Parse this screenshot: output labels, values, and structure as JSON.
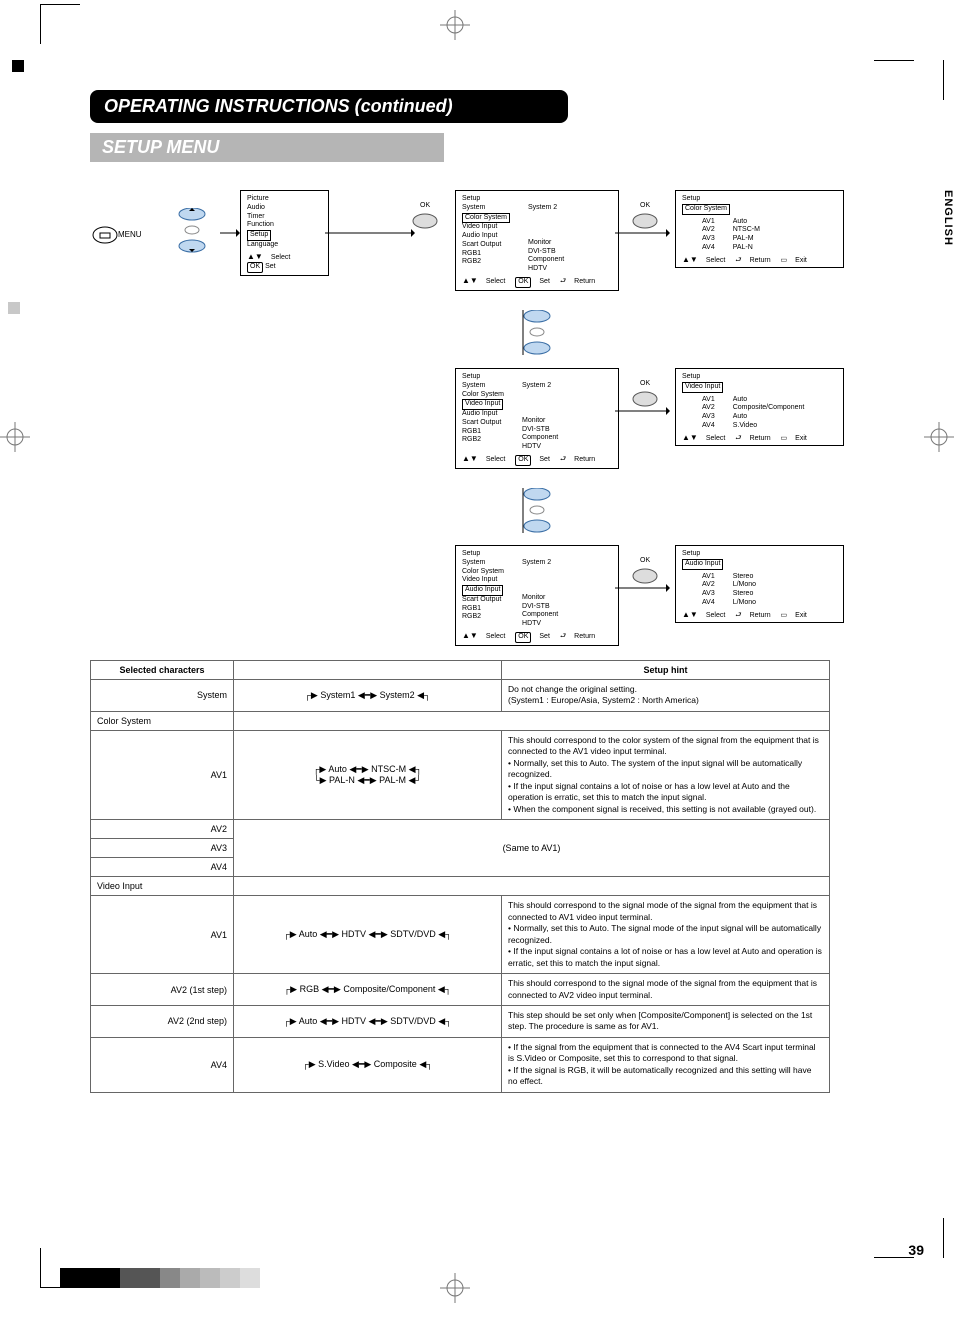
{
  "header": {
    "title": "OPERATING INSTRUCTIONS (continued)",
    "subtitle": "SETUP MENU"
  },
  "lang": "ENGLISH",
  "pagenum": "39",
  "menu_button": "MENU",
  "ok_label": "OK",
  "main_menu": {
    "items": [
      "Picture",
      "Audio",
      "Timer",
      "Function",
      "Setup",
      "Language"
    ],
    "selected": "Setup",
    "footer_select": "Select",
    "footer_set": "Set",
    "footer_ok": "OK"
  },
  "setup_panel": {
    "title": "Setup",
    "right_col": [
      "System 2",
      "",
      "",
      "",
      "Monitor",
      "DVI-STB",
      "Component",
      "HDTV"
    ],
    "items": [
      "System",
      "Color System",
      "Video Input",
      "Audio Input",
      "Scart Output",
      "RGB1",
      "RGB2"
    ],
    "footer_select": "Select",
    "footer_set": "Set",
    "footer_return": "Return",
    "footer_ok": "OK"
  },
  "color_system": {
    "title": "Setup",
    "selected": "Color System",
    "rows": [
      [
        "AV1",
        "Auto"
      ],
      [
        "AV2",
        "NTSC-M"
      ],
      [
        "AV3",
        "PAL-M"
      ],
      [
        "AV4",
        "PAL-N"
      ]
    ],
    "footer_select": "Select",
    "footer_return": "Return",
    "footer_exit": "Exit"
  },
  "video_input": {
    "title": "Setup",
    "selected": "Video Input",
    "rows": [
      [
        "AV1",
        "Auto"
      ],
      [
        "AV2",
        "Composite/Component"
      ],
      [
        "AV3",
        "Auto"
      ],
      [
        "AV4",
        "S.Video"
      ]
    ],
    "footer_select": "Select",
    "footer_return": "Return",
    "footer_exit": "Exit"
  },
  "audio_input": {
    "title": "Setup",
    "selected": "Audio Input",
    "rows": [
      [
        "AV1",
        "Stereo"
      ],
      [
        "AV2",
        "L/Mono"
      ],
      [
        "AV3",
        "Stereo"
      ],
      [
        "AV4",
        "L/Mono"
      ]
    ],
    "footer_select": "Select",
    "footer_return": "Return",
    "footer_exit": "Exit"
  },
  "setup_sel": {
    "cs": "Color System",
    "vi": "Video Input",
    "ai": "Audio Input"
  },
  "table": {
    "head_left": "Selected characters",
    "head_right": "Setup hint",
    "rows": [
      {
        "label": "System",
        "opts": [
          "System1",
          "System2"
        ],
        "hint": "Do not change the original setting.\n(System1 : Europe/Asia, System2 : North America)"
      },
      {
        "label": "Color System",
        "opts": null,
        "hint": ""
      },
      {
        "label": "AV1",
        "opts": [
          "Auto",
          "NTSC-M",
          "PAL-N",
          "PAL-M"
        ],
        "twoLine": true,
        "hint": "This should correspond to the color system of the signal from the equipment that is connected to the AV1 video input terminal.\n• Normally, set this to Auto. The system of the input signal will be automatically recognized.\n• If the input signal contains a lot of noise or has a low level at Auto and the operation is erratic, set this to match the input signal.\n• When the component signal is received, this setting is not available (grayed out)."
      },
      {
        "label": "AV2",
        "opts": null,
        "span": true
      },
      {
        "label": "AV3",
        "opts": null,
        "middle": "(Same to AV1)"
      },
      {
        "label": "AV4",
        "opts": null
      },
      {
        "label": "Video Input",
        "opts": null,
        "hint": ""
      },
      {
        "label": "AV1",
        "opts": [
          "Auto",
          "HDTV",
          "SDTV/DVD"
        ],
        "hint": "This should correspond to the signal mode of the signal from the equipment that is connected to AV1 video input terminal.\n• Normally, set this to Auto. The signal mode of the input signal will be automatically recognized.\n• If the input signal contains a lot of noise or has a low level at Auto and operation is erratic, set this to match the input signal."
      },
      {
        "label": "AV2 (1st step)",
        "opts": [
          "RGB",
          "Composite/Component"
        ],
        "hint": "This should correspond to the signal mode of the signal from the equipment that is connected to AV2 video input terminal."
      },
      {
        "label": "AV2 (2nd step)",
        "opts": [
          "Auto",
          "HDTV",
          "SDTV/DVD"
        ],
        "hint": "This step should be set only when [Composite/Component] is selected on the 1st step. The procedure is same as for AV1."
      },
      {
        "label": "AV4",
        "opts": [
          "S.Video",
          "Composite"
        ],
        "hint": "• If the signal from the equipment that is connected to the AV4 Scart input terminal is S.Video or Composite, set this to correspond to that signal.\n• If the signal is RGB, it will be automatically recognized and this setting will have no effect."
      }
    ]
  }
}
